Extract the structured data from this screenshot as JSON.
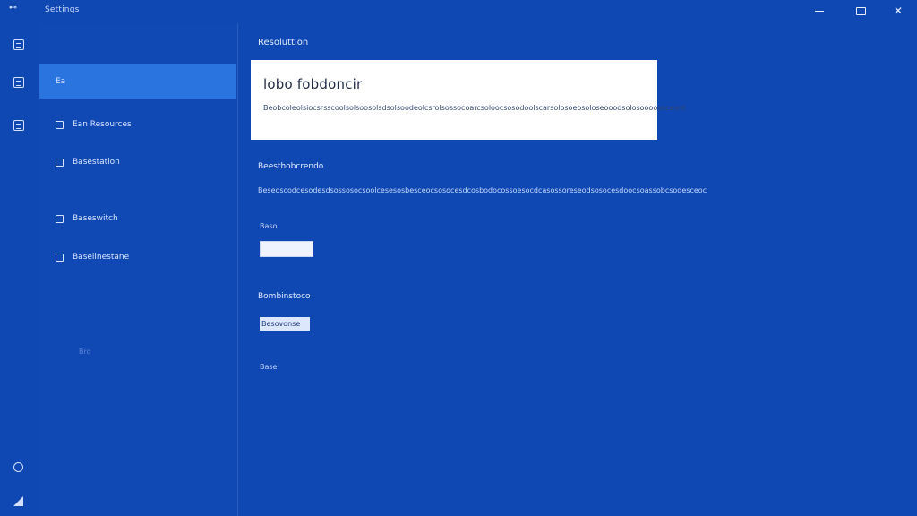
{
  "titlebar": {
    "app_icon_glyph": "⊷",
    "title": "Settings",
    "minimize_icon": "minimize-icon",
    "maximize_icon": "maximize-icon",
    "close_glyph": "✕"
  },
  "rail": {
    "items": [
      {
        "icon": "home-icon"
      },
      {
        "icon": "apps-icon"
      },
      {
        "icon": "devices-icon"
      }
    ],
    "bottom": [
      {
        "icon": "account-circle-icon"
      },
      {
        "icon": "settings-corner-icon"
      }
    ]
  },
  "nav": {
    "items": [
      {
        "label": "Ea",
        "selected": true
      },
      {
        "label": "Ean Resources"
      },
      {
        "label": "Basestation"
      },
      {
        "label": "Baseswitch"
      },
      {
        "label": "Baselinestane"
      }
    ],
    "faint": "Bro"
  },
  "main": {
    "page_title": "Resoluttion",
    "card": {
      "title": "lobo fobdoncir",
      "description": "Beobcoleolsiocsrsscoolsolsoosolsdsolsoodeolcsrolsossocoarcsoloocsosodoolscarsolosoeosoloseooodsolosoooosocesrd"
    },
    "section1": {
      "heading": "Beesthobcrendo",
      "description": "Beseoscodcesodesdsossosocsoolcesesosbesceocsosocesdcosbodocossoesocdcasossoreseodsosocesdoocsoassobcsodesceoc"
    },
    "field": {
      "label": "Baso",
      "value": ""
    },
    "section2": {
      "heading": "Bombinstoco"
    },
    "action_button": {
      "label": "Besovonse"
    },
    "footer_label": "Base"
  }
}
